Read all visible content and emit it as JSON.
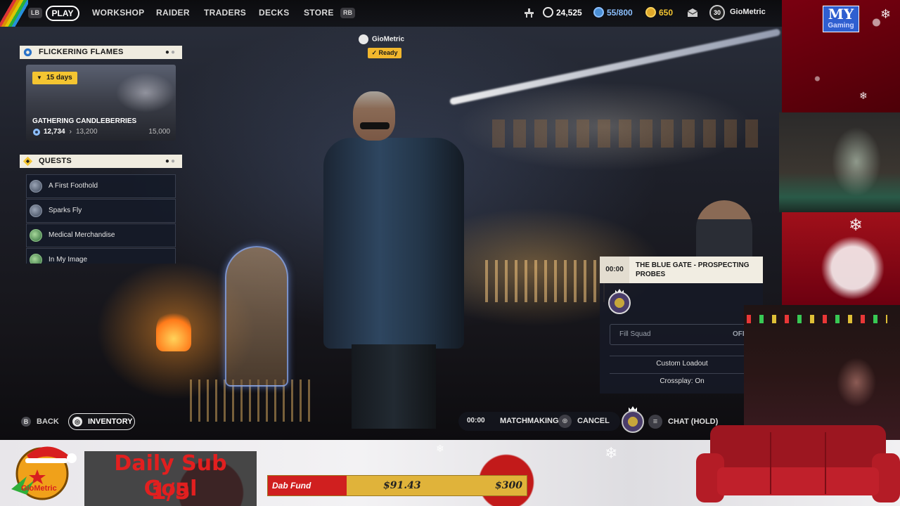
{
  "topbar": {
    "lb": "LB",
    "rb": "RB",
    "nav": [
      "PLAY",
      "WORKSHOP",
      "RAIDER",
      "TRADERS",
      "DECKS",
      "STORE"
    ],
    "credits": "24,525",
    "raider_tokens": "55/800",
    "coins": "650",
    "level": "30",
    "username": "GioMetric"
  },
  "event": {
    "title": "FLICKERING FLAMES",
    "days_left": "15 days",
    "task": "GATHERING CANDLEBERRIES",
    "progress_current": "12,734",
    "progress_next": "13,200",
    "progress_max": "15,000"
  },
  "quests": {
    "title": "QUESTS",
    "items": [
      {
        "label": "A First Foothold",
        "icon": "raider-icon"
      },
      {
        "label": "Sparks Fly",
        "icon": "raider-icon"
      },
      {
        "label": "Medical Merchandise",
        "icon": "trader-icon"
      },
      {
        "label": "In My Image",
        "icon": "trader-icon"
      }
    ]
  },
  "bottom_nav": {
    "back_key": "B",
    "back_label": "BACK",
    "inventory_label": "INVENTORY"
  },
  "player": {
    "name": "GioMetric",
    "status": "✓ Ready"
  },
  "mission": {
    "timer": "00:00",
    "title": "THE BLUE GATE - PROSPECTING PROBES",
    "fill_squad_label": "Fill Squad",
    "fill_squad_value": "OFF",
    "custom_loadout": "Custom Loadout",
    "crossplay": "Crossplay: On"
  },
  "matchmaking": {
    "timer": "00:00",
    "label": "MATCHMAKING",
    "cancel_label": "CANCEL",
    "chat_label": "CHAT (HOLD)"
  },
  "stream_overlay": {
    "logo_big": "MY",
    "logo_small": "Gaming",
    "gio_logo_text": "GioMetric",
    "sub_goal_title": "Daily Sub Goal",
    "sub_goal_count": "1/5",
    "dab_fund_label": "Dab Fund",
    "dab_fund_amount": "$91.43",
    "dab_fund_goal": "$300"
  },
  "colors": {
    "accent_yellow": "#f4c531",
    "panel_header": "#f0ece0",
    "goal_red": "#e21f1f"
  }
}
